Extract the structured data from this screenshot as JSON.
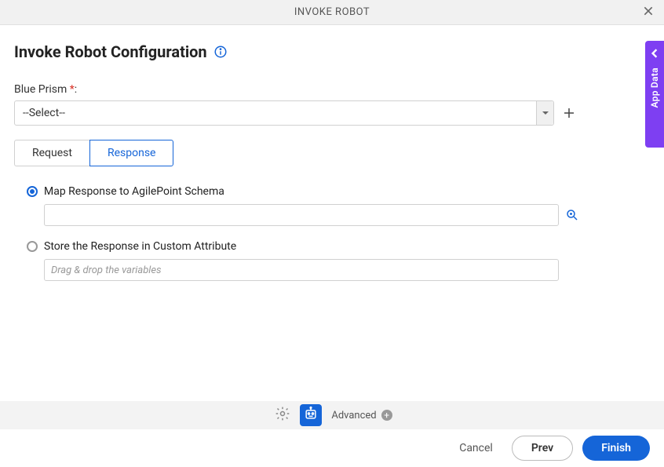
{
  "title_bar": {
    "text": "INVOKE ROBOT"
  },
  "page_title": "Invoke Robot Configuration",
  "form": {
    "blue_prism_label": "Blue Prism ",
    "required_mark": "*",
    "colon": ":",
    "select_value": "--Select--"
  },
  "tabs": {
    "request": "Request",
    "response": "Response"
  },
  "radios": {
    "map_schema": "Map Response to AgilePoint Schema",
    "store_custom": "Store the Response in Custom Attribute",
    "store_placeholder": "Drag & drop the variables"
  },
  "side_panel": {
    "label": "App Data"
  },
  "bottom_toolbar": {
    "advanced": "Advanced"
  },
  "footer": {
    "cancel": "Cancel",
    "prev": "Prev",
    "finish": "Finish"
  }
}
